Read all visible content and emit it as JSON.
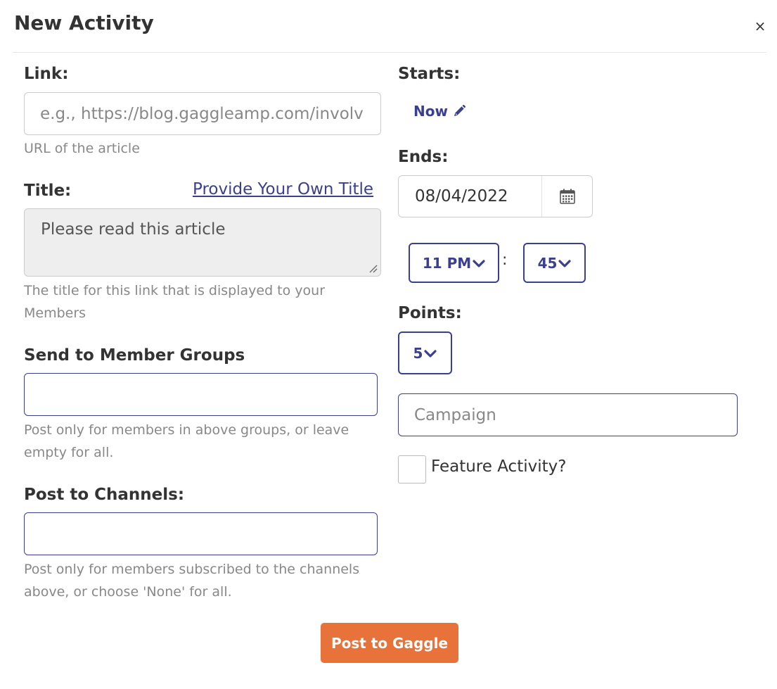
{
  "header": {
    "title": "New Activity",
    "close_icon": "close-icon",
    "close_glyph": "×"
  },
  "link": {
    "label": "Link:",
    "placeholder": "e.g., https://blog.gaggleamp.com/involv",
    "help": "URL of the article"
  },
  "title": {
    "label": "Title:",
    "own_title_link": "Provide Your Own Title",
    "value": "Please read this article",
    "help": "The title for this link that is displayed to your Members"
  },
  "member_groups": {
    "label": "Send to Member Groups",
    "value": "",
    "help": "Post only for members in above groups, or leave empty for all."
  },
  "channels": {
    "label": "Post to Channels:",
    "value": "",
    "help": "Post only for members subscribed to the channels above, or choose 'None' for all."
  },
  "starts": {
    "label": "Starts:",
    "value": "Now",
    "icon": "pencil-icon"
  },
  "ends": {
    "label": "Ends:",
    "date": "08/04/2022",
    "calendar_icon": "calendar-icon",
    "hour": "11 PM",
    "separator": ":",
    "minute": "45"
  },
  "points": {
    "label": "Points:",
    "value": "5"
  },
  "campaign": {
    "placeholder": "Campaign"
  },
  "feature": {
    "label": "Feature Activity?",
    "checked": false
  },
  "submit": {
    "label": "Post to Gaggle"
  },
  "colors": {
    "accent_blue": "#3b3f8f",
    "submit_orange": "#e8733a",
    "help_gray": "#888888"
  }
}
